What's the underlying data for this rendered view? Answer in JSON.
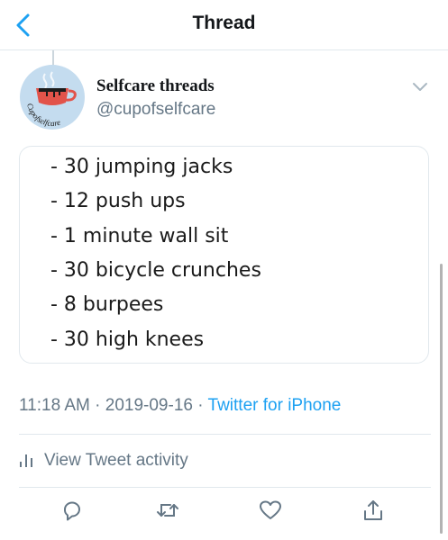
{
  "nav": {
    "title": "Thread",
    "back_icon": "chevron-left-icon"
  },
  "tweet": {
    "name": "Selfcare threads",
    "handle": "@cupofselfcare",
    "avatar_text": "Cupofselfcare",
    "card_lines": [
      "- 30 jumping jacks",
      "- 12 push ups",
      "- 1 minute wall sit",
      "- 30 bicycle crunches",
      "- 8 burpees",
      "- 30 high knees"
    ],
    "time": "11:18 AM",
    "date": "2019-09-16",
    "separator": "·",
    "source": "Twitter for iPhone"
  },
  "activity": {
    "label": "View Tweet activity",
    "icon": "bar-chart-icon"
  },
  "actions": [
    {
      "name": "reply",
      "icon": "reply-icon"
    },
    {
      "name": "retweet",
      "icon": "retweet-icon"
    },
    {
      "name": "like",
      "icon": "heart-icon"
    },
    {
      "name": "share",
      "icon": "share-icon"
    }
  ],
  "colors": {
    "accent": "#1da1f2",
    "muted": "#657786",
    "divider": "#e1e8ed",
    "avatar_bg": "#c4dcef",
    "cup": "#e2534a"
  }
}
